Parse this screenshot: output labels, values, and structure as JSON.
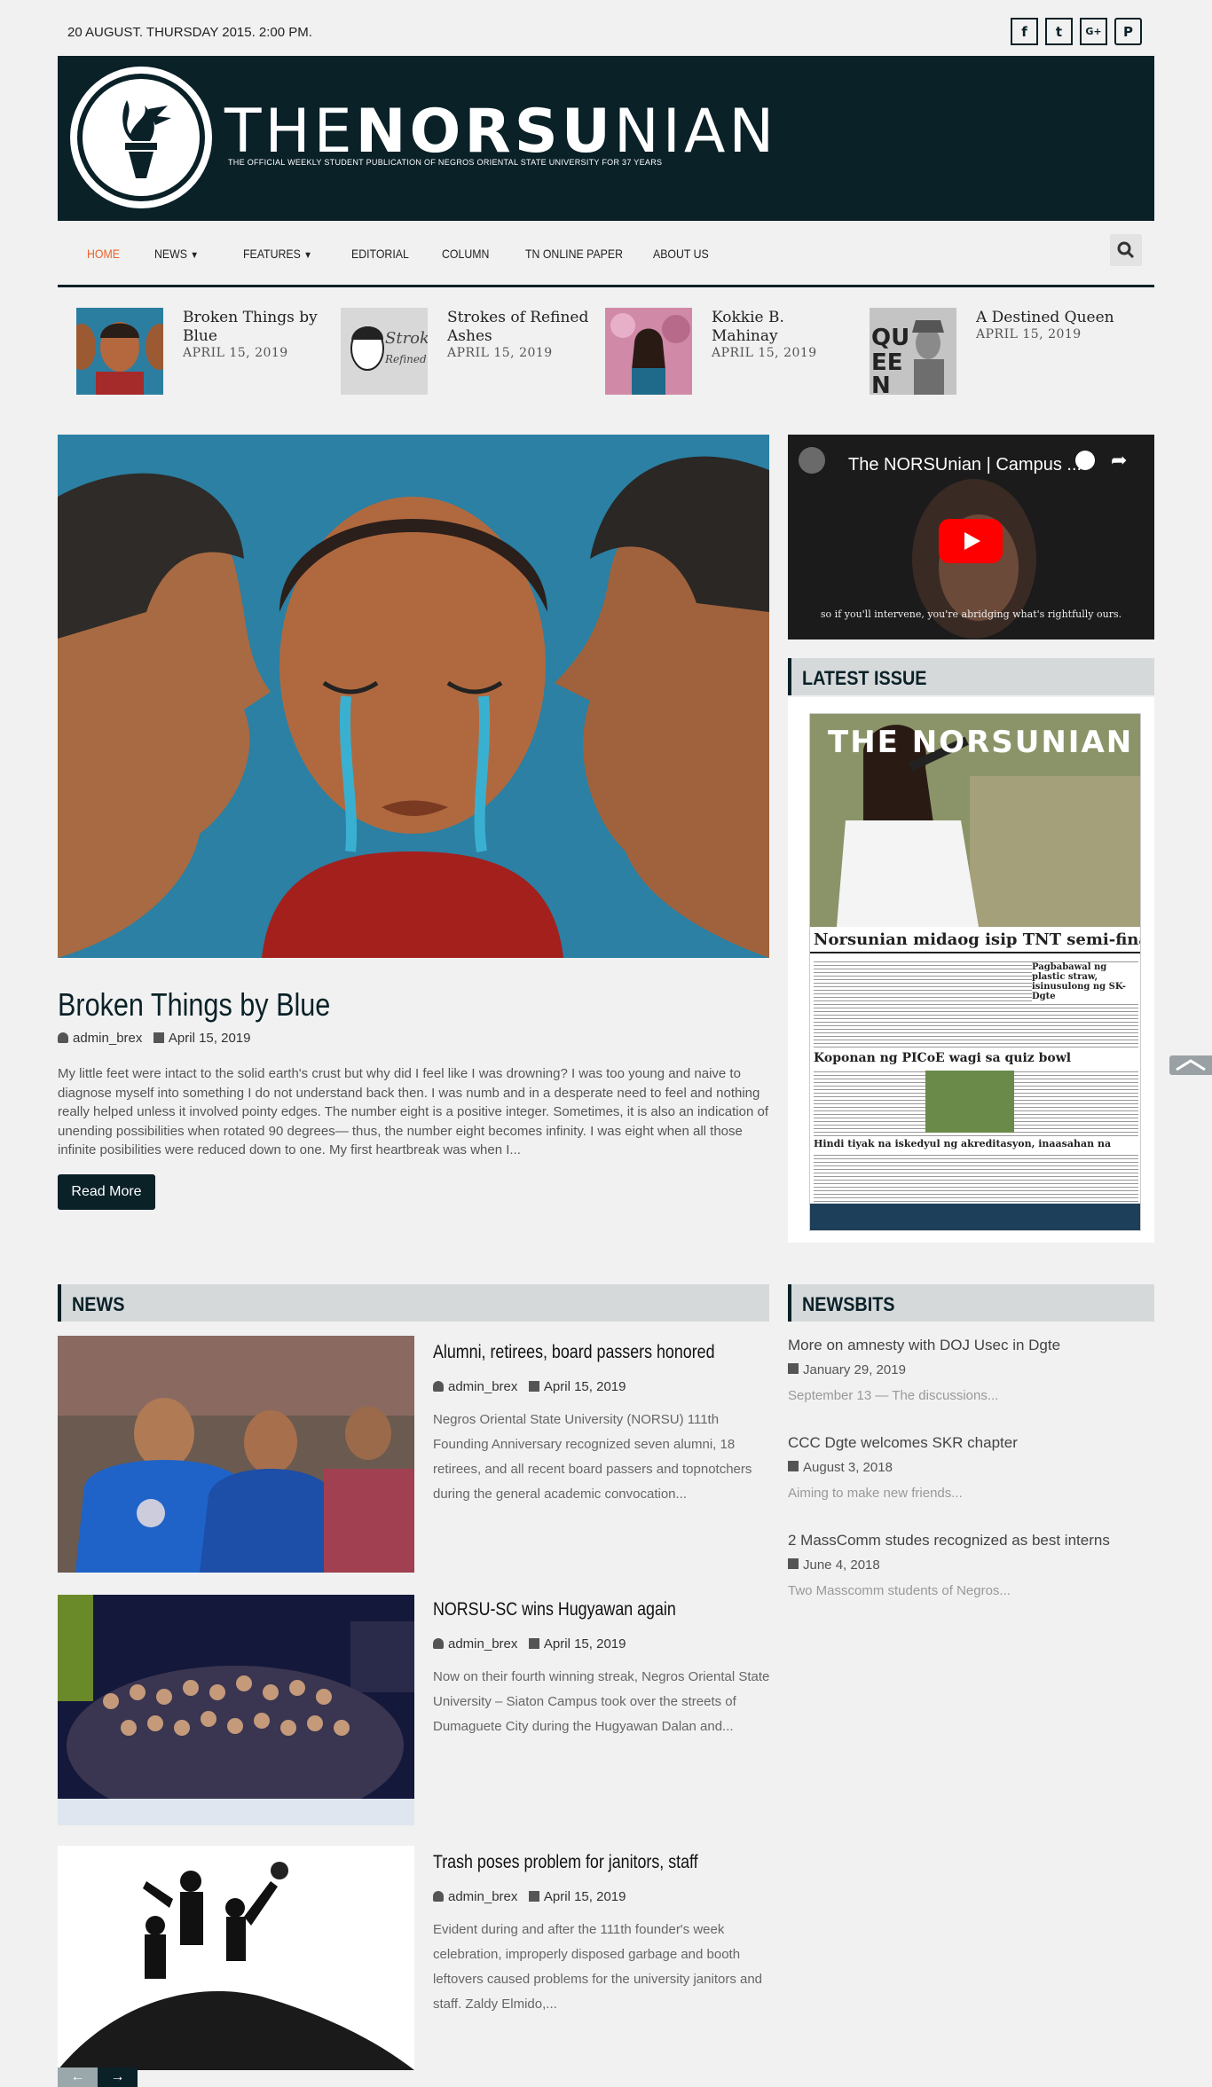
{
  "topbar": {
    "date": "20 AUGUST. THURSDAY 2015. 2:00 PM.",
    "social": [
      "f",
      "t",
      "G+",
      "P"
    ]
  },
  "site": {
    "title_thin1": "THE",
    "title_bold": "NORSU",
    "title_thin2": "NIAN",
    "tagline": "THE OFFICIAL WEEKLY STUDENT PUBLICATION OF NEGROS ORIENTAL STATE UNIVERSITY FOR 37 YEARS"
  },
  "nav": {
    "items": [
      "HOME",
      "NEWS",
      "FEATURES",
      "EDITORIAL",
      "COLUMN",
      "TN ONLINE PAPER",
      "ABOUT US"
    ]
  },
  "ticker": [
    {
      "title": "Broken Things by Blue",
      "date": "APRIL 15, 2019"
    },
    {
      "title": "Strokes of Refined Ashes",
      "date": "APRIL 15, 2019"
    },
    {
      "title": "Kokkie B. Mahinay",
      "date": "APRIL 15, 2019"
    },
    {
      "title": "A Destined Queen",
      "date": "APRIL 15, 2019"
    }
  ],
  "hero": {
    "title": "Broken Things by Blue",
    "author": "admin_brex",
    "date": "April 15, 2019",
    "excerpt": "My little feet were intact to the solid earth's crust but why did I feel like I was drowning? I was too young and naive to diagnose myself into something I do not understand back then. I was numb and in a desperate need to feel and nothing really helped unless it involved pointy edges. The number eight is a positive integer. Sometimes, it is also an indication of unending possibilities when rotated 90 degrees— thus, the number eight becomes infinity. I was eight when all those infinite posibilities were reduced down to one. My first heartbreak was when I...",
    "read_more": "Read More"
  },
  "video": {
    "title": "The NORSUnian | Campus ...",
    "caption": "so if you'll intervene, you're abridging what's rightfully ours."
  },
  "latest_issue": {
    "heading": "LATEST ISSUE",
    "paper_masthead": "THE NORSUNIAN",
    "paper_headline": "Norsunian midaog isip TNT semi-finalist",
    "paper_sub1": "Koponan ng PICoE wagi sa quiz bowl",
    "paper_sub2": "Hindi tiyak na iskedyul ng akreditasyon, inaasahan na",
    "paper_side": "Pagbabawal ng plastic straw, isinusulong ng SK-Dgte"
  },
  "news": {
    "heading": "NEWS",
    "items": [
      {
        "title": "Alumni, retirees, board passers honored",
        "author": "admin_brex",
        "date": "April 15, 2019",
        "excerpt": "Negros Oriental State University (NORSU) 111th Founding Anniversary recognized seven alumni, 18 retirees, and all recent board passers and topnotchers during the general academic convocation..."
      },
      {
        "title": "NORSU-SC wins Hugyawan again",
        "author": "admin_brex",
        "date": "April 15, 2019",
        "excerpt": "Now on their fourth winning streak, Negros Oriental State University – Siaton Campus took over the streets of Dumaguete City during the Hugyawan Dalan and..."
      },
      {
        "title": "Trash poses problem for janitors, staff",
        "author": "admin_brex",
        "date": "April 15, 2019",
        "excerpt": "Evident during and after the 111th founder's week celebration, improperly disposed garbage and booth leftovers caused problems for the university janitors and staff. Zaldy Elmido,..."
      }
    ]
  },
  "newsbits": {
    "heading": "NEWSBITS",
    "items": [
      {
        "title": "More on amnesty with DOJ Usec in Dgte",
        "date": "January 29, 2019",
        "excerpt": "September 13 — The discussions..."
      },
      {
        "title": "CCC Dgte welcomes SKR chapter",
        "date": "August 3, 2018",
        "excerpt": "Aiming to make new friends..."
      },
      {
        "title": "2 MassComm studes recognized as best interns",
        "date": "June 4, 2018",
        "excerpt": "Two Masscomm  students of Negros..."
      }
    ]
  },
  "pager": {
    "prev": "←",
    "next": "→"
  },
  "colors": {
    "brand": "#0a2128",
    "accent": "#e8632b"
  }
}
